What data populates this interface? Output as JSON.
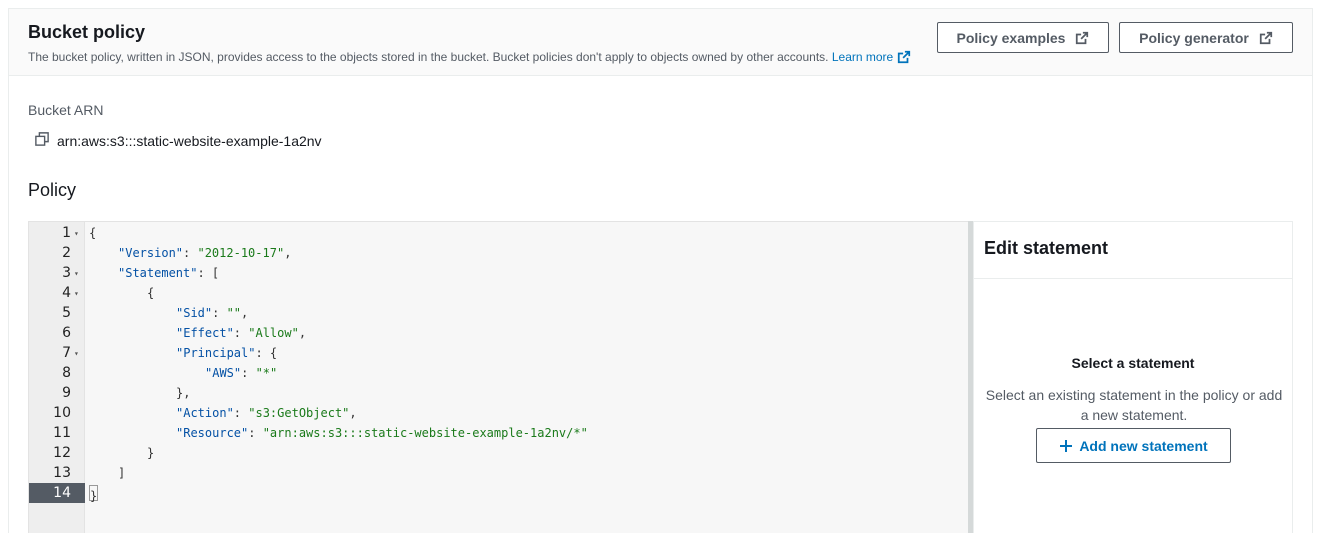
{
  "header": {
    "title": "Bucket policy",
    "description": "The bucket policy, written in JSON, provides access to the objects stored in the bucket. Bucket policies don't apply to objects owned by other accounts.",
    "learn_more": "Learn more",
    "policy_examples_label": "Policy examples",
    "policy_generator_label": "Policy generator"
  },
  "arn": {
    "label": "Bucket ARN",
    "value": "arn:aws:s3:::static-website-example-1a2nv"
  },
  "policy": {
    "title": "Policy",
    "active_line": 14,
    "lines": [
      {
        "n": "1",
        "fold": true,
        "indent": 0,
        "tokens": [
          {
            "t": "p",
            "v": "{"
          }
        ]
      },
      {
        "n": "2",
        "fold": false,
        "indent": 1,
        "tokens": [
          {
            "t": "k",
            "v": "\"Version\""
          },
          {
            "t": "p",
            "v": ": "
          },
          {
            "t": "s",
            "v": "\"2012-10-17\""
          },
          {
            "t": "p",
            "v": ","
          }
        ]
      },
      {
        "n": "3",
        "fold": true,
        "indent": 1,
        "tokens": [
          {
            "t": "k",
            "v": "\"Statement\""
          },
          {
            "t": "p",
            "v": ": ["
          }
        ]
      },
      {
        "n": "4",
        "fold": true,
        "indent": 2,
        "tokens": [
          {
            "t": "p",
            "v": "{"
          }
        ]
      },
      {
        "n": "5",
        "fold": false,
        "indent": 3,
        "tokens": [
          {
            "t": "k",
            "v": "\"Sid\""
          },
          {
            "t": "p",
            "v": ": "
          },
          {
            "t": "s",
            "v": "\"\""
          },
          {
            "t": "p",
            "v": ","
          }
        ]
      },
      {
        "n": "6",
        "fold": false,
        "indent": 3,
        "tokens": [
          {
            "t": "k",
            "v": "\"Effect\""
          },
          {
            "t": "p",
            "v": ": "
          },
          {
            "t": "s",
            "v": "\"Allow\""
          },
          {
            "t": "p",
            "v": ","
          }
        ]
      },
      {
        "n": "7",
        "fold": true,
        "indent": 3,
        "tokens": [
          {
            "t": "k",
            "v": "\"Principal\""
          },
          {
            "t": "p",
            "v": ": {"
          }
        ]
      },
      {
        "n": "8",
        "fold": false,
        "indent": 4,
        "tokens": [
          {
            "t": "k",
            "v": "\"AWS\""
          },
          {
            "t": "p",
            "v": ": "
          },
          {
            "t": "s",
            "v": "\"*\""
          }
        ]
      },
      {
        "n": "9",
        "fold": false,
        "indent": 3,
        "tokens": [
          {
            "t": "p",
            "v": "},"
          }
        ]
      },
      {
        "n": "10",
        "fold": false,
        "indent": 3,
        "tokens": [
          {
            "t": "k",
            "v": "\"Action\""
          },
          {
            "t": "p",
            "v": ": "
          },
          {
            "t": "s",
            "v": "\"s3:GetObject\""
          },
          {
            "t": "p",
            "v": ","
          }
        ]
      },
      {
        "n": "11",
        "fold": false,
        "indent": 3,
        "tokens": [
          {
            "t": "k",
            "v": "\"Resource\""
          },
          {
            "t": "p",
            "v": ": "
          },
          {
            "t": "s",
            "v": "\"arn:aws:s3:::static-website-example-1a2nv/*\""
          }
        ]
      },
      {
        "n": "12",
        "fold": false,
        "indent": 2,
        "tokens": [
          {
            "t": "p",
            "v": "}"
          }
        ]
      },
      {
        "n": "13",
        "fold": false,
        "indent": 1,
        "tokens": [
          {
            "t": "p",
            "v": "]"
          }
        ]
      },
      {
        "n": "14",
        "fold": false,
        "indent": 0,
        "tokens": [
          {
            "t": "p",
            "v": "}"
          }
        ]
      }
    ]
  },
  "edit_statement": {
    "title": "Edit statement",
    "empty_title": "Select a statement",
    "empty_desc": "Select an existing statement in the policy or add a new statement.",
    "add_label": "Add new statement"
  },
  "colors": {
    "link": "#0073bb",
    "json_key": "#0451a5",
    "json_string": "#1a7a1a",
    "active_gutter": "#545b64"
  },
  "icons": [
    "external-link-icon",
    "copy-icon",
    "fold-arrow-icon",
    "plus-icon"
  ]
}
